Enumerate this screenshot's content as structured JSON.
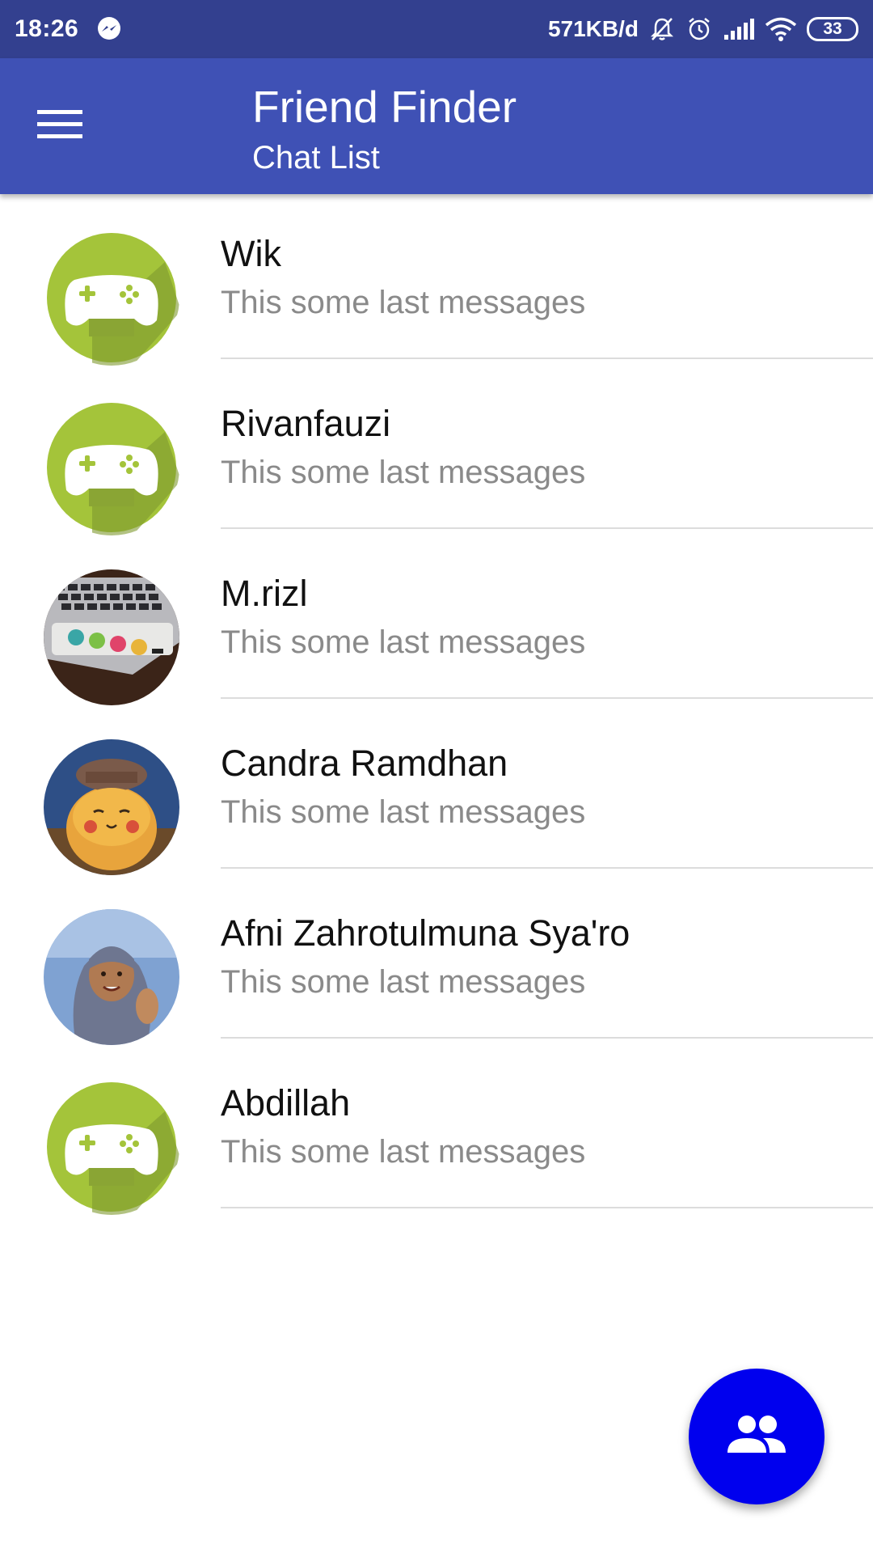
{
  "status_bar": {
    "time": "18:26",
    "network_speed": "571KB/d",
    "battery": "33",
    "icons": [
      "messenger-icon",
      "mute-icon",
      "alarm-icon",
      "signal-icon",
      "wifi-icon",
      "battery-icon"
    ]
  },
  "app_bar": {
    "title": "Friend Finder",
    "subtitle": "Chat List",
    "menu_icon": "hamburger-menu-icon",
    "color": "#3f51b5"
  },
  "chats": [
    {
      "name": "Wik",
      "last_message": "This some last messages",
      "avatar": "game-controller-icon"
    },
    {
      "name": "Rivanfauzi",
      "last_message": "This some last messages",
      "avatar": "game-controller-icon"
    },
    {
      "name": "M.rizl",
      "last_message": "This some last messages",
      "avatar": "photo-avatar"
    },
    {
      "name": "Candra Ramdhan",
      "last_message": "This some last messages",
      "avatar": "photo-avatar"
    },
    {
      "name": "Afni Zahrotulmuna Sya'ro",
      "last_message": "This some last messages",
      "avatar": "photo-avatar"
    },
    {
      "name": "Abdillah",
      "last_message": "This some last messages",
      "avatar": "game-controller-icon"
    }
  ],
  "fab": {
    "icon": "people-icon",
    "color": "#0000ee"
  }
}
